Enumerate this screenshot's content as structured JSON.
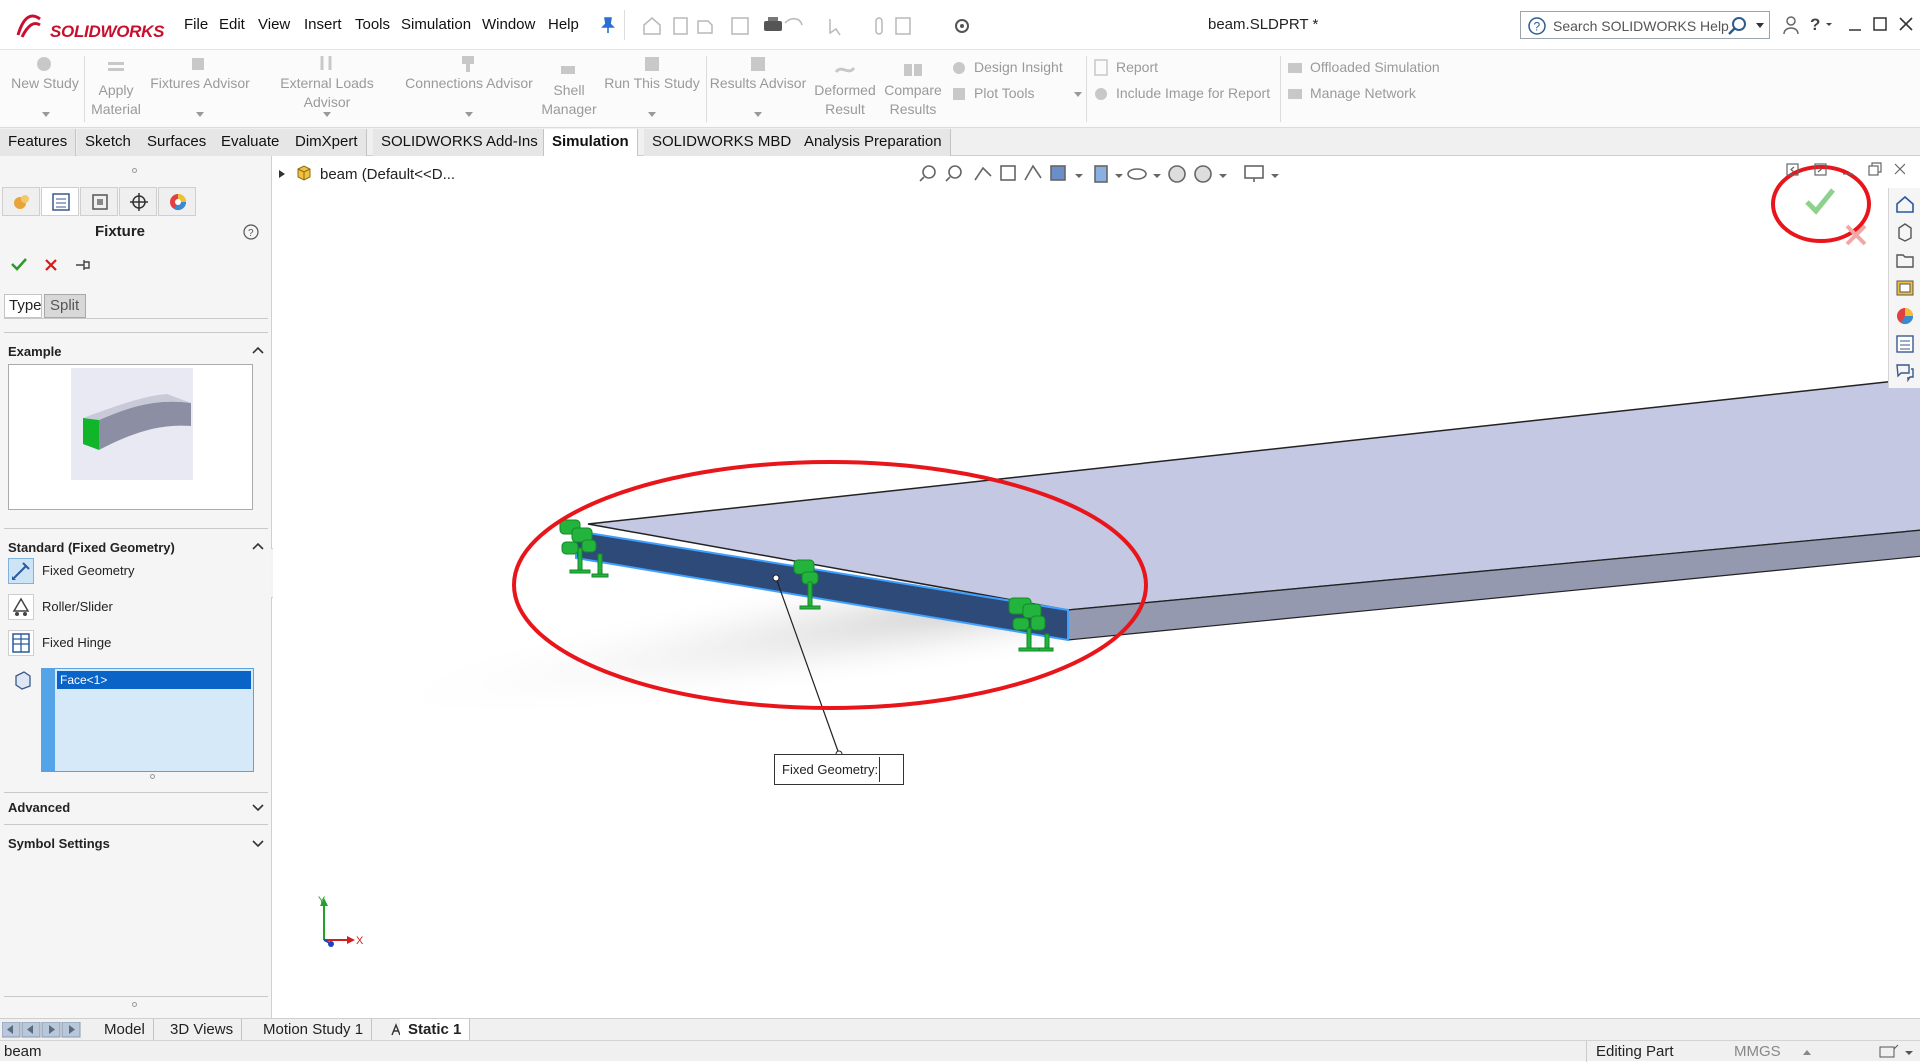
{
  "app": {
    "logo_text": "SOLIDWORKS",
    "document_title": "beam.SLDPRT *",
    "menu": [
      "File",
      "Edit",
      "View",
      "Insert",
      "Tools",
      "Simulation",
      "Window",
      "Help"
    ],
    "help_search_placeholder": "Search SOLIDWORKS Help"
  },
  "command_manager": {
    "new_study": "New Study",
    "apply_material_1": "Apply",
    "apply_material_2": "Material",
    "fixtures_advisor": "Fixtures Advisor",
    "external_loads_advisor": "External Loads Advisor",
    "connections_advisor": "Connections Advisor",
    "shell_manager_1": "Shell",
    "shell_manager_2": "Manager",
    "run_this_study": "Run This Study",
    "results_advisor": "Results Advisor",
    "deformed_result_1": "Deformed",
    "deformed_result_2": "Result",
    "compare_results_1": "Compare",
    "compare_results_2": "Results",
    "design_insight": "Design Insight",
    "plot_tools": "Plot Tools",
    "report": "Report",
    "include_image_for_report": "Include Image for Report",
    "offloaded_simulation": "Offloaded Simulation",
    "manage_network": "Manage Network"
  },
  "tabs": [
    "Features",
    "Sketch",
    "Surfaces",
    "Evaluate",
    "DimXpert",
    "SOLIDWORKS Add-Ins",
    "Simulation",
    "SOLIDWORKS MBD",
    "Analysis Preparation"
  ],
  "active_tab": "Simulation",
  "property_manager": {
    "title": "Fixture",
    "subtabs": [
      "Type",
      "Split"
    ],
    "example_heading": "Example",
    "standard_heading": "Standard (Fixed Geometry)",
    "options": [
      "Fixed Geometry",
      "Roller/Slider",
      "Fixed Hinge"
    ],
    "selected_option": "Fixed Geometry",
    "selection_list": [
      "Face<1>"
    ],
    "advanced_heading": "Advanced",
    "symbol_settings_heading": "Symbol Settings"
  },
  "graphics": {
    "tree_item": "beam  (Default<<D...",
    "callout_label": "Fixed Geometry:",
    "triad_x": "X",
    "triad_y": "Y"
  },
  "bottom_tabs": [
    "Model",
    "3D Views",
    "Motion Study 1",
    "Static 1"
  ],
  "active_bottom_tab": "Static 1",
  "status": {
    "left": "beam",
    "mode": "Editing Part",
    "units": "MMGS"
  },
  "colors": {
    "accent_red": "#e8161b",
    "fixture_green": "#22b43c",
    "beam_top": "#c4c8e2",
    "beam_face_selected": "#2e4a78",
    "selection_blue": "#0a64c8"
  }
}
